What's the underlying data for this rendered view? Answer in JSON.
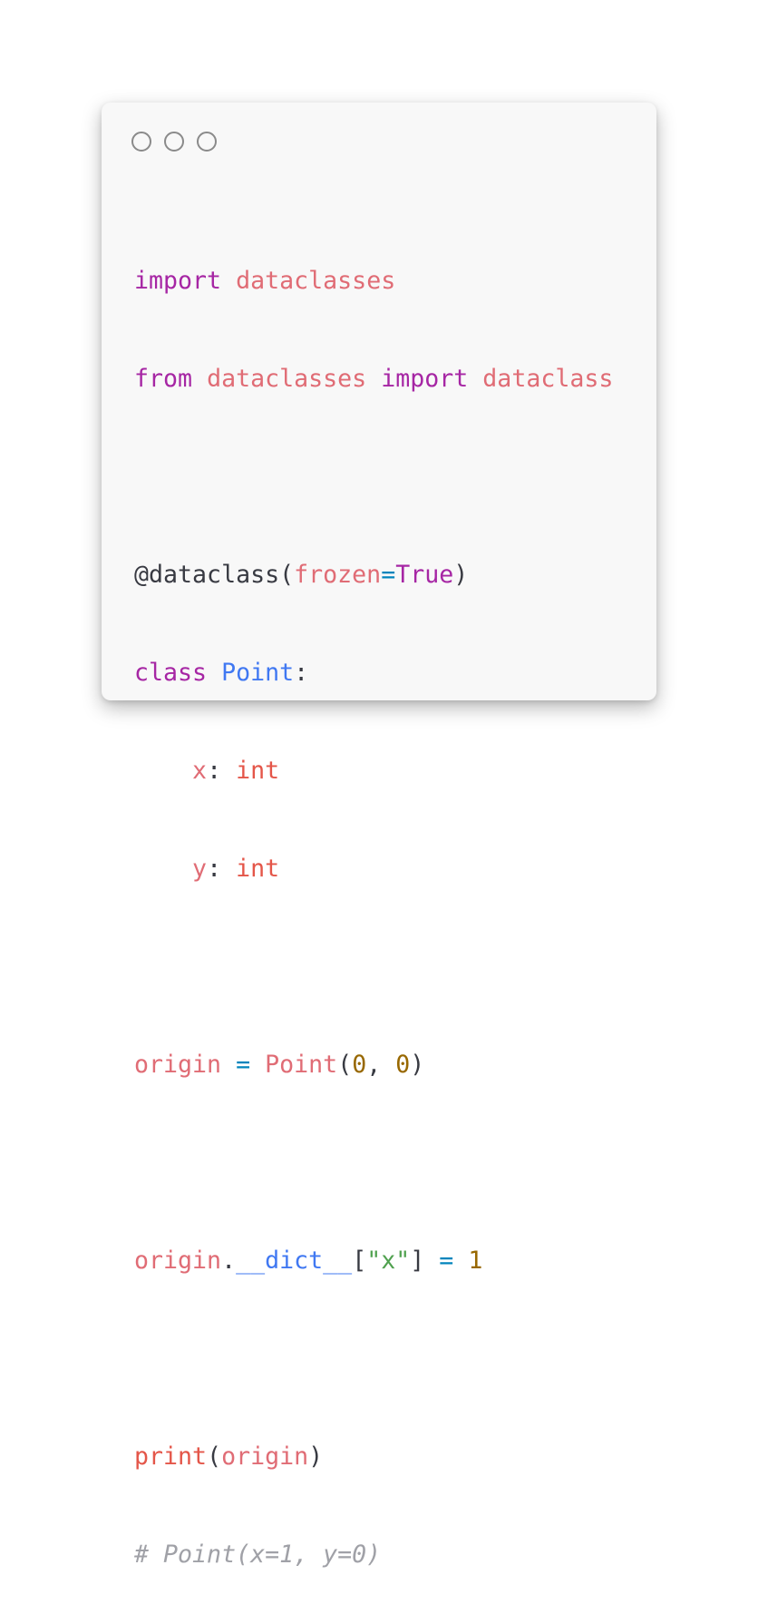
{
  "window": {
    "controls": [
      "close",
      "minimize",
      "maximize"
    ]
  },
  "code": {
    "l1": {
      "kw": "import",
      "mod": "dataclasses"
    },
    "l2": {
      "kw1": "from",
      "mod1": "dataclasses",
      "kw2": "import",
      "mod2": "dataclass"
    },
    "l4": {
      "deco": "@dataclass",
      "open": "(",
      "param": "frozen",
      "eq": "=",
      "val": "True",
      "close": ")"
    },
    "l5": {
      "kw": "class",
      "name": "Point",
      "colon": ":"
    },
    "l6": {
      "indent": "    ",
      "field": "x",
      "colon": ": ",
      "type": "int"
    },
    "l7": {
      "indent": "    ",
      "field": "y",
      "colon": ": ",
      "type": "int"
    },
    "l9": {
      "var": "origin",
      "eq": " = ",
      "fn": "Point",
      "open": "(",
      "a": "0",
      "comma": ", ",
      "b": "0",
      "close": ")"
    },
    "l11": {
      "var": "origin",
      "dot": ".",
      "attr": "__dict__",
      "lb": "[",
      "key": "\"x\"",
      "rb": "]",
      "eq": " = ",
      "val": "1"
    },
    "l13": {
      "fn": "print",
      "open": "(",
      "arg": "origin",
      "close": ")"
    },
    "l14": {
      "comment": "# Point(x=1, y=0)"
    }
  },
  "colors": {
    "keyword": "#a626a4",
    "identifier": "#e06c75",
    "builtin": "#e45649",
    "class": "#4078f2",
    "operator": "#0184bc",
    "number": "#986801",
    "string": "#50a14f",
    "comment": "#a0a1a7"
  }
}
